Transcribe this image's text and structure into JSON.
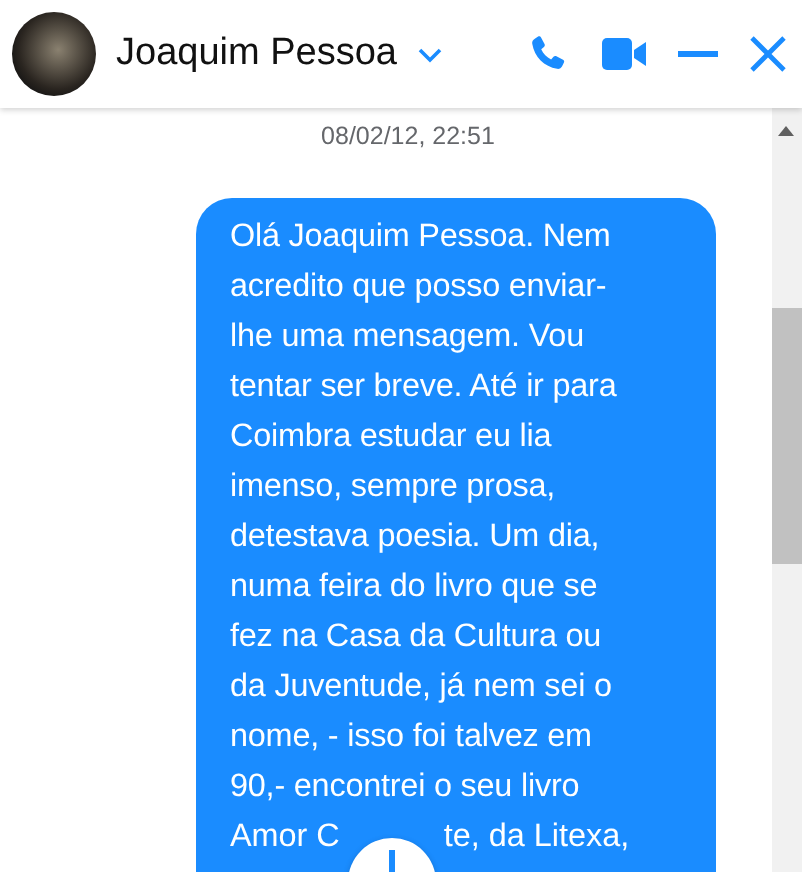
{
  "header": {
    "name": "Joaquim Pessoa"
  },
  "timestamp": "08/02/12, 22:51",
  "message": {
    "lines": [
      "Olá Joaquim Pessoa. Nem",
      "acredito que posso enviar-",
      "lhe uma mensagem. Vou",
      "tentar ser breve. Até ir para",
      "Coimbra estudar eu lia",
      "imenso, sempre prosa,",
      "detestava poesia. Um dia,",
      "numa feira do livro que se",
      "fez na Casa da Cultura ou",
      "da Juventude, já nem sei o",
      "nome, - isso foi talvez em",
      "90,-  encontrei o seu livro"
    ],
    "last_line": [
      "Amor C",
      "te, da Litexa,"
    ]
  }
}
